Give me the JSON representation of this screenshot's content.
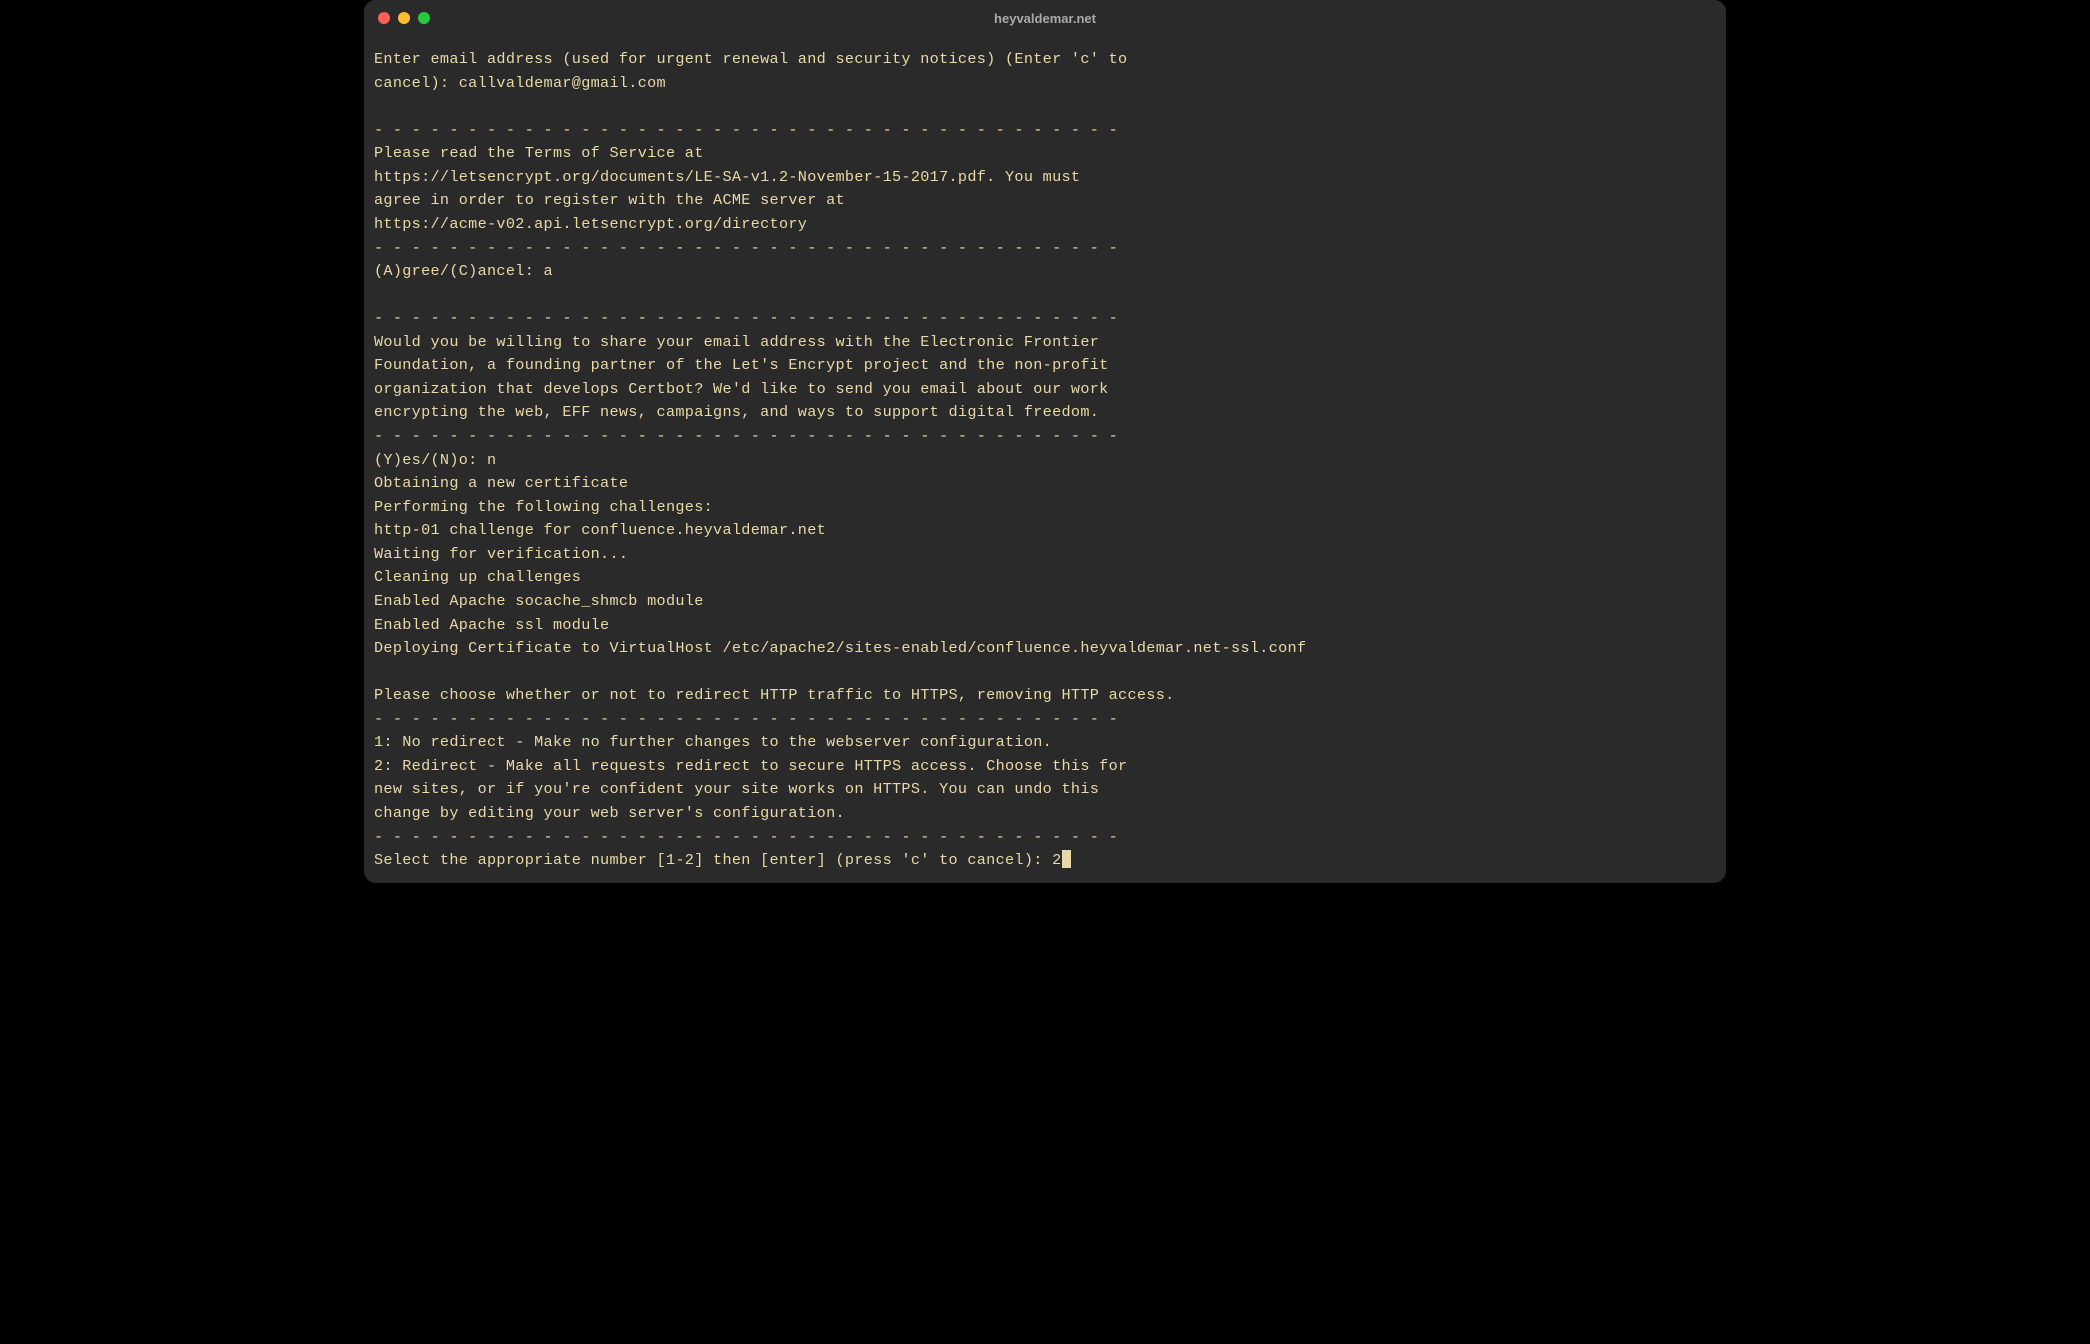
{
  "window": {
    "title": "heyvaldemar.net"
  },
  "colors": {
    "bg": "#2a2a2a",
    "text": "#e8d9a6",
    "red": "#ff5f56",
    "yellow": "#ffbd2e",
    "green": "#27c93f"
  },
  "terminal": {
    "lines": [
      "Enter email address (used for urgent renewal and security notices) (Enter 'c' to",
      "cancel): callvaldemar@gmail.com",
      "",
      "- - - - - - - - - - - - - - - - - - - - - - - - - - - - - - - - - - - - - - - -",
      "Please read the Terms of Service at",
      "https://letsencrypt.org/documents/LE-SA-v1.2-November-15-2017.pdf. You must",
      "agree in order to register with the ACME server at",
      "https://acme-v02.api.letsencrypt.org/directory",
      "- - - - - - - - - - - - - - - - - - - - - - - - - - - - - - - - - - - - - - - -",
      "(A)gree/(C)ancel: a",
      "",
      "- - - - - - - - - - - - - - - - - - - - - - - - - - - - - - - - - - - - - - - -",
      "Would you be willing to share your email address with the Electronic Frontier",
      "Foundation, a founding partner of the Let's Encrypt project and the non-profit",
      "organization that develops Certbot? We'd like to send you email about our work",
      "encrypting the web, EFF news, campaigns, and ways to support digital freedom.",
      "- - - - - - - - - - - - - - - - - - - - - - - - - - - - - - - - - - - - - - - -",
      "(Y)es/(N)o: n",
      "Obtaining a new certificate",
      "Performing the following challenges:",
      "http-01 challenge for confluence.heyvaldemar.net",
      "Waiting for verification...",
      "Cleaning up challenges",
      "Enabled Apache socache_shmcb module",
      "Enabled Apache ssl module",
      "Deploying Certificate to VirtualHost /etc/apache2/sites-enabled/confluence.heyvaldemar.net-ssl.conf",
      "",
      "Please choose whether or not to redirect HTTP traffic to HTTPS, removing HTTP access.",
      "- - - - - - - - - - - - - - - - - - - - - - - - - - - - - - - - - - - - - - - -",
      "1: No redirect - Make no further changes to the webserver configuration.",
      "2: Redirect - Make all requests redirect to secure HTTPS access. Choose this for",
      "new sites, or if you're confident your site works on HTTPS. You can undo this",
      "change by editing your web server's configuration.",
      "- - - - - - - - - - - - - - - - - - - - - - - - - - - - - - - - - - - - - - - -"
    ],
    "prompt_line": "Select the appropriate number [1-2] then [enter] (press 'c' to cancel): 2",
    "inputs": {
      "email": "callvaldemar@gmail.com",
      "agree": "a",
      "share_email": "n",
      "redirect_choice": "2"
    }
  }
}
